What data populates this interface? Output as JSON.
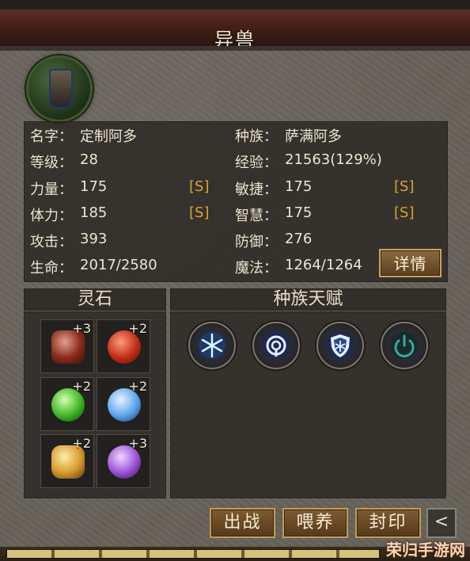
{
  "title": "异兽",
  "stats_left": [
    {
      "label": "名字：",
      "value": "定制阿多",
      "tag": ""
    },
    {
      "label": "等级：",
      "value": "28",
      "tag": ""
    },
    {
      "label": "力量：",
      "value": "175",
      "tag": "[S]"
    },
    {
      "label": "体力：",
      "value": "185",
      "tag": "[S]"
    },
    {
      "label": "攻击：",
      "value": "393",
      "tag": ""
    },
    {
      "label": "生命：",
      "value": "2017/2580",
      "tag": ""
    }
  ],
  "stats_right": [
    {
      "label": "种族：",
      "value": "萨满阿多",
      "tag": ""
    },
    {
      "label": "经验：",
      "value": "21563(129%)",
      "tag": ""
    },
    {
      "label": "敏捷：",
      "value": "175",
      "tag": "[S]"
    },
    {
      "label": "智慧：",
      "value": "175",
      "tag": "[S]"
    },
    {
      "label": "防御：",
      "value": "276",
      "tag": ""
    },
    {
      "label": "魔法：",
      "value": "1264/1264",
      "tag": ""
    }
  ],
  "detail_button": "详情",
  "spirit_stones": {
    "header": "灵石",
    "slots": [
      {
        "icon": "rune-stone-icon",
        "count": "+3",
        "color": "#b8321e"
      },
      {
        "icon": "red-orb-icon",
        "count": "+2",
        "color": "#d0341c"
      },
      {
        "icon": "green-orb-icon",
        "count": "+2",
        "color": "#4cc12e"
      },
      {
        "icon": "blue-orb-icon",
        "count": "+2",
        "color": "#5aa8f0"
      },
      {
        "icon": "gold-rune-icon",
        "count": "+2",
        "color": "#d9a43a"
      },
      {
        "icon": "purple-orb-icon",
        "count": "+3",
        "color": "#a05ad8"
      }
    ]
  },
  "race_talent": {
    "header": "种族天赋",
    "icons": [
      "snowflake-icon",
      "spiral-icon",
      "frost-shield-icon",
      "power-icon"
    ]
  },
  "actions": {
    "battle": "出战",
    "feed": "喂养",
    "seal": "封印",
    "back": "<"
  },
  "watermark": "荣归手游网"
}
